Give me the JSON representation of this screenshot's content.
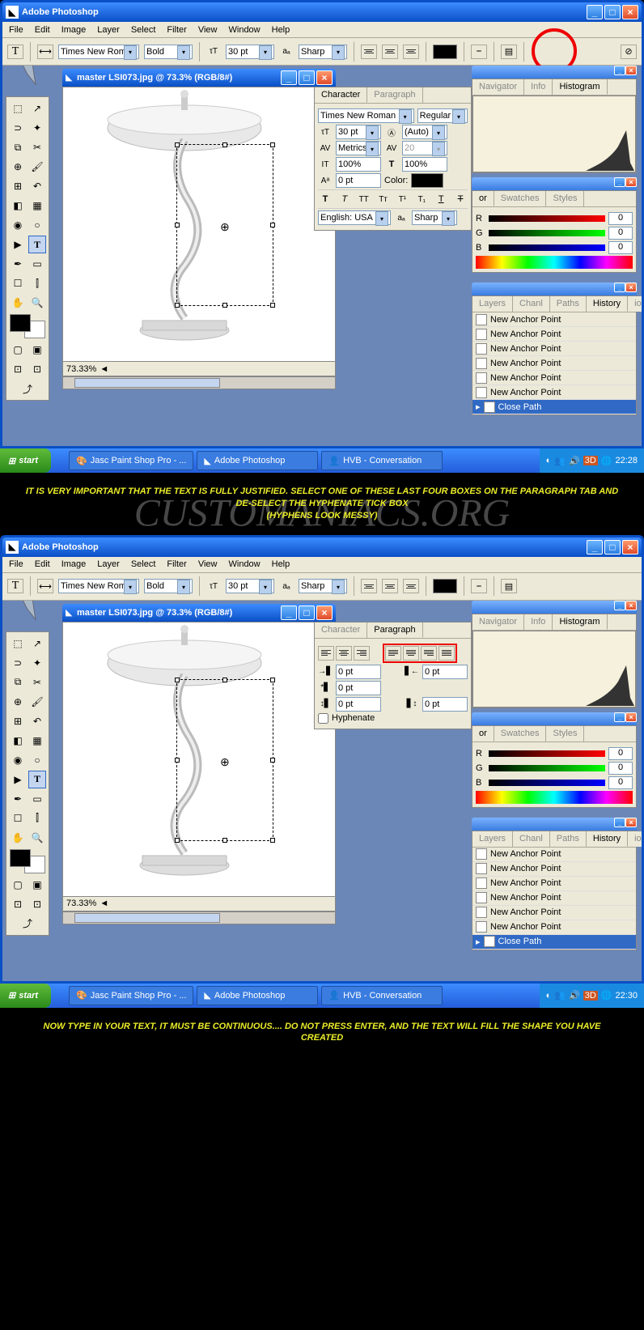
{
  "app": {
    "title": "Adobe Photoshop"
  },
  "menu": [
    "File",
    "Edit",
    "Image",
    "Layer",
    "Select",
    "Filter",
    "View",
    "Window",
    "Help"
  ],
  "optbar": {
    "font": "Times New Roman",
    "weight": "Bold",
    "size": "30 pt",
    "aa": "Sharp"
  },
  "doc": {
    "title": "master LSI073.jpg @ 73.3% (RGB/8#)",
    "zoom": "73.33%"
  },
  "char_panel": {
    "tabs": [
      "Character",
      "Paragraph"
    ],
    "font": "Times New Roman",
    "style": "Regular",
    "size": "30 pt",
    "leading": "(Auto)",
    "kerning": "Metrics",
    "tracking": "20",
    "vscale": "100%",
    "hscale": "100%",
    "baseline": "0 pt",
    "color_label": "Color:",
    "lang": "English: USA",
    "aa": "Sharp"
  },
  "para_panel": {
    "tabs": [
      "Character",
      "Paragraph"
    ],
    "indent_left": "0 pt",
    "indent_right": "0 pt",
    "indent_first": "0 pt",
    "space_before": "0 pt",
    "space_after": "0 pt",
    "hyphenate": "Hyphenate"
  },
  "nav_tabs": [
    "Navigator",
    "Info",
    "Histogram"
  ],
  "color_tabs": [
    "or",
    "Swatches",
    "Styles"
  ],
  "rgb": {
    "r": "0",
    "g": "0",
    "b": "0"
  },
  "hist_tabs": [
    "Layers",
    "Chanl",
    "Paths",
    "History",
    "ions"
  ],
  "history": [
    "New Anchor Point",
    "New Anchor Point",
    "New Anchor Point",
    "New Anchor Point",
    "New Anchor Point",
    "New Anchor Point",
    "Close Path"
  ],
  "taskbar": {
    "start": "start",
    "tasks": [
      "Jasc Paint Shop Pro - ...",
      "Adobe Photoshop",
      "HVB - Conversation"
    ],
    "time1": "22:28",
    "time2": "22:30"
  },
  "caption1": "IT IS VERY IMPORTANT THAT THE TEXT IS FULLY JUSTIFIED. SELECT ONE OF THESE LAST FOUR BOXES ON THE PARAGRAPH TAB AND DE-SELECT THE HYPHENATE TICK BOX",
  "caption1b": "(HYPHENS LOOK MESSY)",
  "watermark": "CUSTOMANIACS.ORG",
  "caption2": "NOW TYPE IN YOUR TEXT, IT MUST BE CONTINUOUS.... DO NOT PRESS ENTER, AND THE TEXT WILL FILL THE SHAPE YOU HAVE CREATED"
}
